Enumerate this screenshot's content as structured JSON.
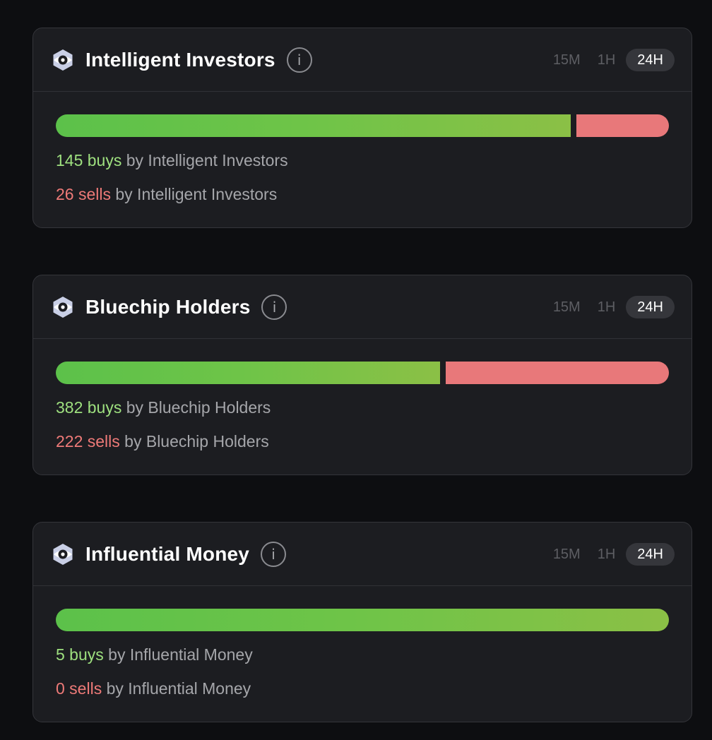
{
  "time_tabs": [
    "15M",
    "1H",
    "24H"
  ],
  "active_tab": "24H",
  "colors": {
    "buy": "#9ee07f",
    "sell": "#ee7a78",
    "bar_sell": "#e8787a"
  },
  "cards": [
    {
      "title": "Intelligent Investors",
      "buys": 145,
      "sells": 26,
      "buy_count_text": "145 buys",
      "buy_suffix": " by Intelligent Investors",
      "sell_count_text": "26 sells",
      "sell_suffix": " by Intelligent Investors"
    },
    {
      "title": "Bluechip Holders",
      "buys": 382,
      "sells": 222,
      "buy_count_text": "382 buys",
      "buy_suffix": " by Bluechip Holders",
      "sell_count_text": "222 sells",
      "sell_suffix": " by Bluechip Holders"
    },
    {
      "title": "Influential Money",
      "buys": 5,
      "sells": 0,
      "buy_count_text": "5 buys",
      "buy_suffix": " by Influential Money",
      "sell_count_text": "0 sells",
      "sell_suffix": " by Influential Money"
    }
  ]
}
